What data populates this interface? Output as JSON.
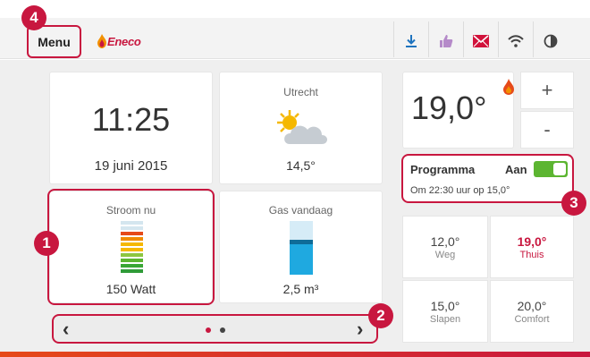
{
  "header": {
    "menu_label": "Menu",
    "logo_text": "Eneco",
    "icons": [
      "download-icon",
      "thumbs-up-icon",
      "mail-icon",
      "wifi-icon",
      "display-mode-icon"
    ]
  },
  "clock": {
    "time": "11:25",
    "date": "19 juni 2015"
  },
  "weather": {
    "city": "Utrecht",
    "temperature": "14,5°",
    "icon": "partly-cloudy-icon"
  },
  "power": {
    "title": "Stroom nu",
    "value": "150 Watt",
    "level_bars": 10
  },
  "gas": {
    "title": "Gas vandaag",
    "value": "2,5 m³",
    "fill_fraction": 0.65
  },
  "pager": {
    "pages": 2,
    "active_page": 1
  },
  "thermostat": {
    "setpoint": "19,0°",
    "heating_icon": "flame-icon",
    "increase_label": "+",
    "decrease_label": "-"
  },
  "program": {
    "title": "Programma",
    "state": "Aan",
    "enabled": true,
    "subtitle": "Om 22:30 uur op 15,0°"
  },
  "presets": [
    {
      "value": "12,0°",
      "label": "Weg"
    },
    {
      "value": "19,0°",
      "label": "Thuis",
      "active": true
    },
    {
      "value": "15,0°",
      "label": "Slapen"
    },
    {
      "value": "20,0°",
      "label": "Comfort"
    }
  ],
  "annotations": {
    "b1": "1",
    "b2": "2",
    "b3": "3",
    "b4": "4"
  },
  "colors": {
    "accent": "#c8173f",
    "toggle_on": "#5cb531",
    "gas_fill": "#1fa9e0"
  }
}
